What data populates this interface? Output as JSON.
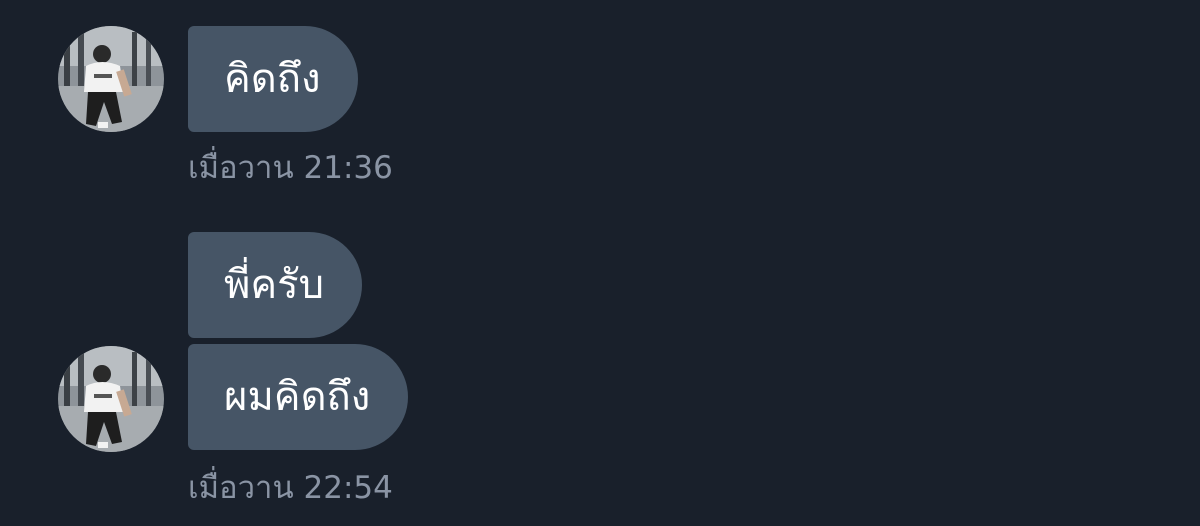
{
  "conversation": {
    "groups": [
      {
        "avatar_icon": "user-avatar-photo",
        "messages": [
          {
            "text": "คิดถึง"
          }
        ],
        "timestamp": "เมื่อวาน 21:36"
      },
      {
        "avatar_icon": "user-avatar-photo",
        "messages": [
          {
            "text": "พี่ครับ"
          },
          {
            "text": "ผมคิดถึง"
          }
        ],
        "timestamp": "เมื่อวาน 22:54"
      }
    ]
  },
  "colors": {
    "background": "#19202b",
    "bubble": "#465566",
    "bubble_text": "#ffffff",
    "timestamp": "#8a94a4"
  }
}
